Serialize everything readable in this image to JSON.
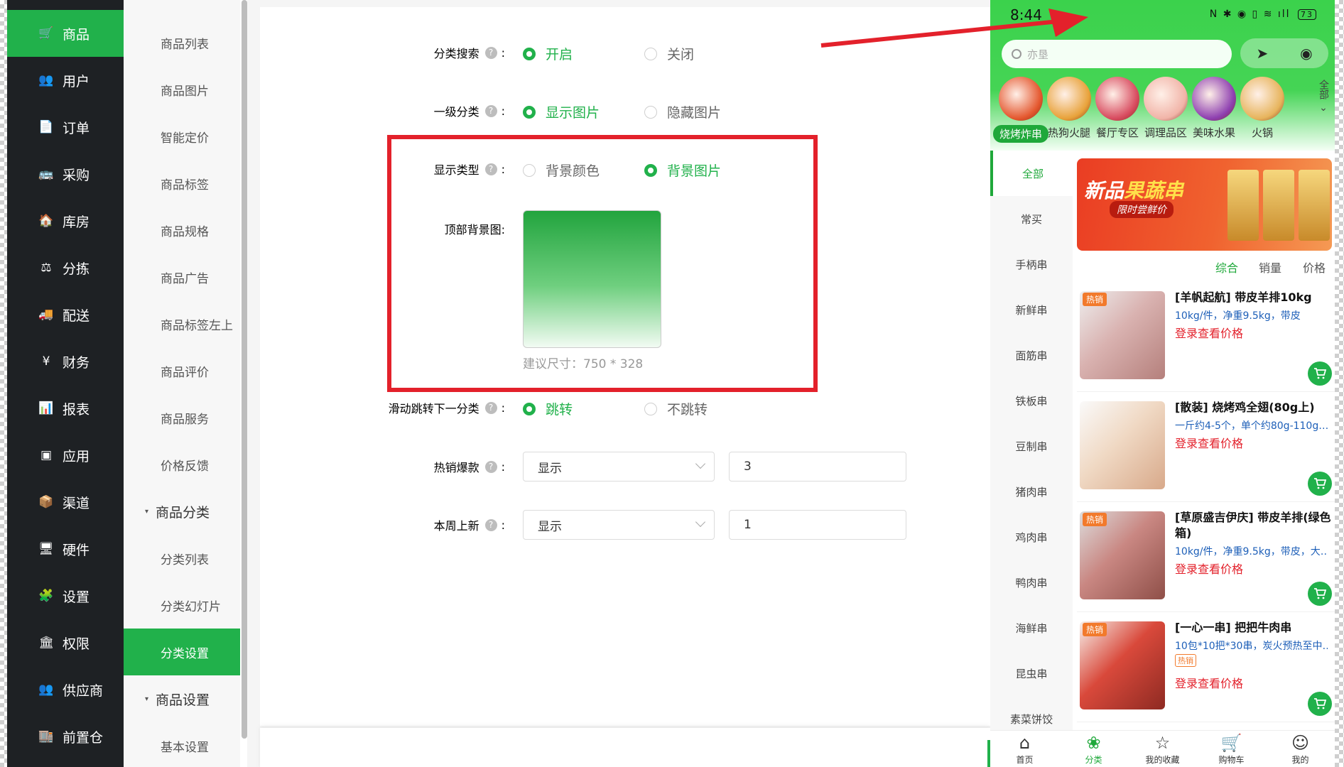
{
  "primary_nav": [
    {
      "label": "商品",
      "icon": "cart-icon",
      "glyph": "🛒",
      "active": true
    },
    {
      "label": "用户",
      "icon": "users-icon",
      "glyph": "👥"
    },
    {
      "label": "订单",
      "icon": "order-icon",
      "glyph": "📄"
    },
    {
      "label": "采购",
      "icon": "purchase-icon",
      "glyph": "🚌"
    },
    {
      "label": "库房",
      "icon": "warehouse-icon",
      "glyph": "🏠"
    },
    {
      "label": "分拣",
      "icon": "scale-icon",
      "glyph": "⚖"
    },
    {
      "label": "配送",
      "icon": "truck-icon",
      "glyph": "🚚"
    },
    {
      "label": "财务",
      "icon": "yen-icon",
      "glyph": "¥"
    },
    {
      "label": "报表",
      "icon": "chart-icon",
      "glyph": "📊"
    },
    {
      "label": "应用",
      "icon": "apps-icon",
      "glyph": "▣"
    },
    {
      "label": "渠道",
      "icon": "box-icon",
      "glyph": "📦"
    },
    {
      "label": "硬件",
      "icon": "monitor-icon",
      "glyph": "🖥"
    },
    {
      "label": "设置",
      "icon": "puzzle-icon",
      "glyph": "🧩"
    },
    {
      "label": "权限",
      "icon": "bank-icon",
      "glyph": "🏛"
    },
    {
      "label": "供应商",
      "icon": "supplier-icon",
      "glyph": "👥"
    },
    {
      "label": "前置仓",
      "icon": "store-icon",
      "glyph": "🏬"
    }
  ],
  "secondary_nav": [
    {
      "label": "商品列表"
    },
    {
      "label": "商品图片"
    },
    {
      "label": "智能定价"
    },
    {
      "label": "商品标签"
    },
    {
      "label": "商品规格"
    },
    {
      "label": "商品广告"
    },
    {
      "label": "商品标签左上"
    },
    {
      "label": "商品评价"
    },
    {
      "label": "商品服务"
    },
    {
      "label": "价格反馈"
    },
    {
      "label": "商品分类",
      "group": true
    },
    {
      "label": "分类列表"
    },
    {
      "label": "分类幻灯片"
    },
    {
      "label": "分类设置",
      "active": true
    },
    {
      "label": "商品设置",
      "group": true
    },
    {
      "label": "基本设置"
    }
  ],
  "form": {
    "category_search": {
      "label": "分类搜索",
      "colon": ":",
      "opt_on": "开启",
      "opt_off": "关闭"
    },
    "level1": {
      "label": "一级分类",
      "colon": ":",
      "opt_on": "显示图片",
      "opt_off": "隐藏图片"
    },
    "display_type": {
      "label": "显示类型",
      "colon": ":",
      "opt_a": "背景颜色",
      "opt_b": "背景图片"
    },
    "top_bg": {
      "label": "顶部背景图:",
      "hint": "建议尺寸：750 * 328"
    },
    "swipe_jump": {
      "label": "滑动跳转下一分类",
      "colon": ":",
      "opt_on": "跳转",
      "opt_off": "不跳转"
    },
    "hot_sales": {
      "label": "热销爆款",
      "colon": ":",
      "select": "显示",
      "count": "3"
    },
    "new_week": {
      "label": "本周上新",
      "colon": ":",
      "select": "显示",
      "count": "1"
    },
    "help_glyph": "?"
  },
  "phone": {
    "time": "8:44",
    "battery": "73",
    "status_icons": "N ✱ ◉ ▯ ≋ ıll",
    "search_placeholder": "亦垦",
    "capsule": {
      "nav": "➤",
      "record": "◉"
    },
    "top_categories": [
      {
        "label": "烧烤炸串",
        "active": true
      },
      {
        "label": "热狗火腿"
      },
      {
        "label": "餐厅专区"
      },
      {
        "label": "调理品区"
      },
      {
        "label": "美味水果"
      },
      {
        "label": "火锅"
      }
    ],
    "all_label": "全部",
    "left_categories": [
      {
        "label": "全部",
        "active": true
      },
      {
        "label": "常买"
      },
      {
        "label": "手柄串"
      },
      {
        "label": "新鲜串"
      },
      {
        "label": "面筋串"
      },
      {
        "label": "铁板串"
      },
      {
        "label": "豆制串"
      },
      {
        "label": "猪肉串"
      },
      {
        "label": "鸡肉串"
      },
      {
        "label": "鸭肉串"
      },
      {
        "label": "海鲜串"
      },
      {
        "label": "昆虫串"
      },
      {
        "label": "素菜饼饺"
      }
    ],
    "banner": {
      "title_a": "新品",
      "title_b": "果蔬串",
      "subtitle": "限时尝鲜价"
    },
    "sort": {
      "all": "综合",
      "sales": "销量",
      "price": "价格"
    },
    "products": [
      {
        "name": "[羊帆起航] 带皮羊排10kg",
        "spec": "10kg/件，净重9.5kg，带皮",
        "price": "登录查看价格",
        "hot": "热销"
      },
      {
        "name": "[散装] 烧烤鸡全翅(80g上)",
        "spec": "一斤约4-5个，单个约80g-110g…",
        "price": "登录查看价格"
      },
      {
        "name": "[草原盛吉伊庆] 带皮羊排(绿色箱)",
        "spec": "10kg/件，净重9.5kg，带皮，大…",
        "price": "登录查看价格",
        "hot": "热销"
      },
      {
        "name": "[一心一串] 把把牛肉串",
        "spec": "10包*10把*30串，炭火预热至中…",
        "price": "登录查看价格",
        "hot": "热销",
        "tag": "热销"
      }
    ],
    "tabs": [
      {
        "label": "首页",
        "glyph": "⌂"
      },
      {
        "label": "分类",
        "glyph": "❀",
        "active": true
      },
      {
        "label": "我的收藏",
        "glyph": "☆"
      },
      {
        "label": "购物车",
        "glyph": "🛒"
      },
      {
        "label": "我的",
        "glyph": "☺"
      }
    ]
  },
  "colors": {
    "accent": "#21b14b",
    "highlight": "#e3212b",
    "sidebar": "#1e2124"
  }
}
